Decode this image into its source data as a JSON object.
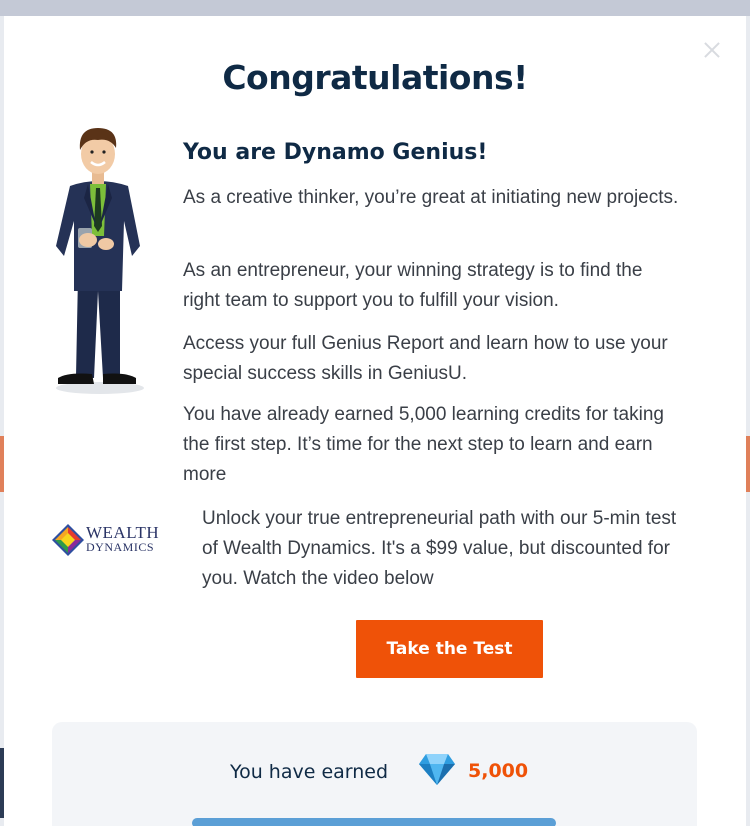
{
  "modal": {
    "title": "Congratulations!",
    "subtitle": "You are Dynamo Genius!",
    "paragraphs": [
      "As a creative thinker, you’re great at initiating new projects.",
      "As an entrepreneur, your winning strategy is to find the right team to support you to fulfill your vision.",
      "Access your full Genius Report and learn how to use your special success skills in GeniusU.",
      "You have already earned 5,000 learning credits for taking the first step. It’s time for the next step to learn and earn more"
    ],
    "wealth_dynamics": {
      "logo_line1": "WEALTH",
      "logo_line2": "DYNAMICS",
      "text": "Unlock your true entrepreneurial path with our 5-min test of Wealth Dynamics. It's a $99 value, but discounted for you. Watch the video below"
    },
    "cta_label": "Take the Test",
    "earned": {
      "label": "You have earned",
      "value": "5,000",
      "icon": "diamond-icon"
    },
    "progress_fraction": 1.0
  },
  "colors": {
    "title": "#0f2a45",
    "accent": "#ef5208",
    "body_text": "#3a3f47",
    "card_bg": "#f3f5f8"
  }
}
